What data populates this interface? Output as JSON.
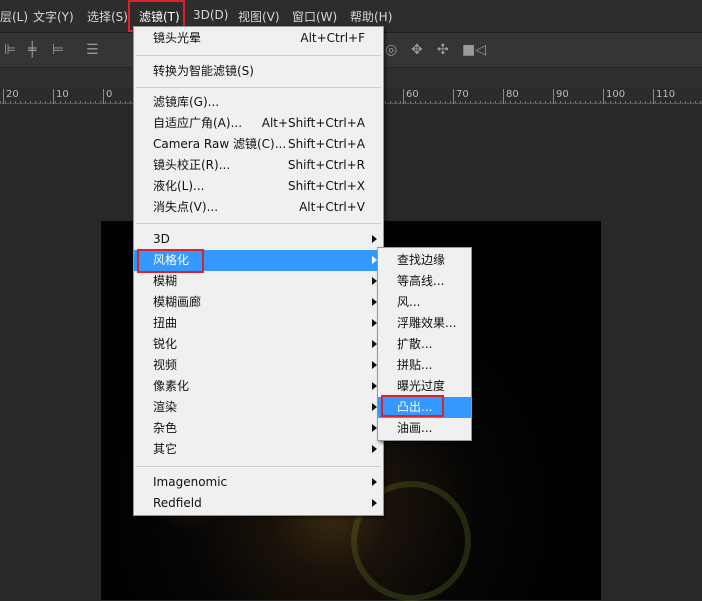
{
  "menubar": {
    "items": [
      "层(L)",
      "文字(Y)",
      "选择(S)",
      "滤镜(T)",
      "3D(D)",
      "视图(V)",
      "窗口(W)",
      "帮助(H)"
    ],
    "active": "滤镜(T)"
  },
  "ruler": {
    "labels": [
      "20",
      "10",
      "0",
      "60",
      "70",
      "80",
      "90",
      "100",
      "110"
    ]
  },
  "filter_menu": {
    "items": [
      {
        "label": "镜头光晕",
        "shortcut": "Alt+Ctrl+F"
      },
      {
        "label": "转换为智能滤镜(S)"
      },
      {
        "label": "滤镜库(G)..."
      },
      {
        "label": "自适应广角(A)...",
        "shortcut": "Alt+Shift+Ctrl+A"
      },
      {
        "label": "Camera Raw 滤镜(C)...",
        "shortcut": "Shift+Ctrl+A"
      },
      {
        "label": "镜头校正(R)...",
        "shortcut": "Shift+Ctrl+R"
      },
      {
        "label": "液化(L)...",
        "shortcut": "Shift+Ctrl+X"
      },
      {
        "label": "消失点(V)...",
        "shortcut": "Alt+Ctrl+V"
      },
      {
        "label": "3D"
      },
      {
        "label": "风格化"
      },
      {
        "label": "模糊"
      },
      {
        "label": "模糊画廊"
      },
      {
        "label": "扭曲"
      },
      {
        "label": "锐化"
      },
      {
        "label": "视频"
      },
      {
        "label": "像素化"
      },
      {
        "label": "渲染"
      },
      {
        "label": "杂色"
      },
      {
        "label": "其它"
      },
      {
        "label": "Imagenomic"
      },
      {
        "label": "Redfield"
      }
    ]
  },
  "stylize_submenu": {
    "items": [
      "查找边缘",
      "等高线...",
      "风...",
      "浮雕效果...",
      "扩散...",
      "拼贴...",
      "曝光过度",
      "凸出...",
      "油画..."
    ],
    "selected": "凸出..."
  },
  "colors": {
    "highlight": "#3399ff",
    "annotation": "#e0202a"
  }
}
